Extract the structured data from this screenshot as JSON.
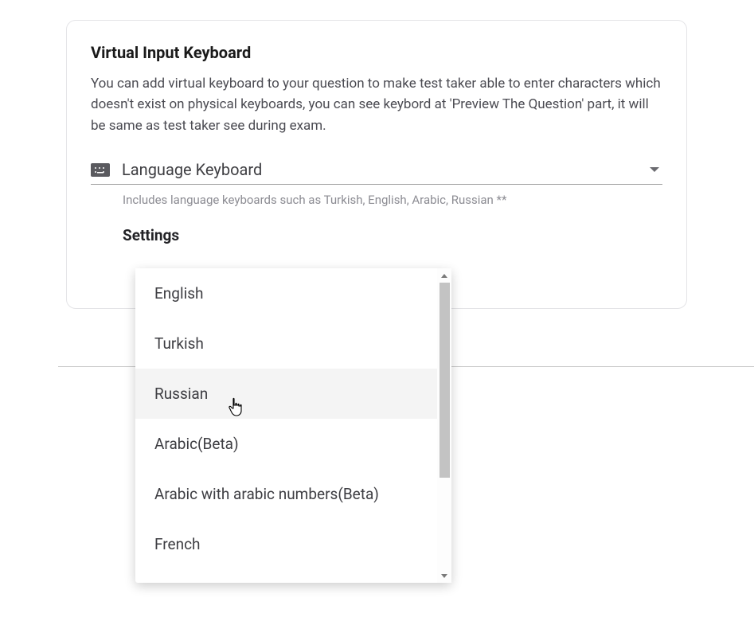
{
  "card": {
    "title": "Virtual Input Keyboard",
    "description": "You can add virtual keyboard to your question to make test taker able to enter characters which doesn't exist on physical keyboards, you can see keybord at 'Preview The Question' part, it will be same as test taker see during exam."
  },
  "select": {
    "label": "Language Keyboard",
    "helper_text": "Includes language keyboards such as Turkish, English, Arabic, Russian **"
  },
  "settings_label": "Settings",
  "dropdown": {
    "options": [
      {
        "label": "English"
      },
      {
        "label": "Turkish"
      },
      {
        "label": "Russian"
      },
      {
        "label": "Arabic(Beta)"
      },
      {
        "label": "Arabic with arabic numbers(Beta)"
      },
      {
        "label": "French"
      }
    ],
    "highlighted_index": 2
  }
}
